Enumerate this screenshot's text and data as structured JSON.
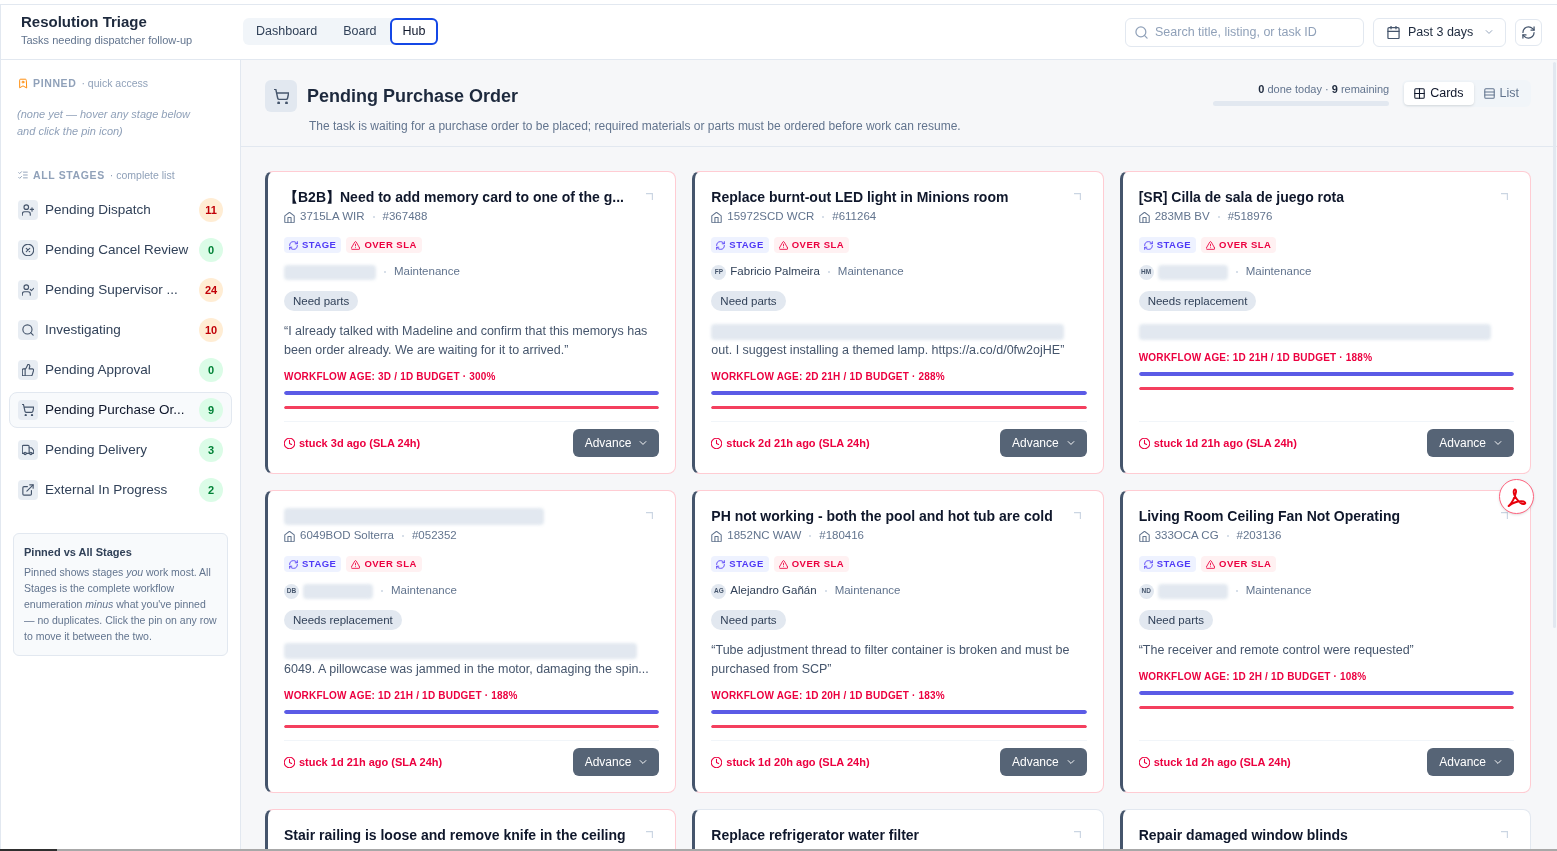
{
  "header": {
    "title": "Resolution Triage",
    "subtitle": "Tasks needing dispatcher follow-up",
    "tabs": [
      {
        "label": "Dashboard",
        "selected": false
      },
      {
        "label": "Board",
        "selected": false
      },
      {
        "label": "Hub",
        "selected": true
      }
    ],
    "search": {
      "placeholder": "Search title, listing, or task ID"
    },
    "date_range": {
      "label": "Past 3 days"
    }
  },
  "sidebar": {
    "pinned": {
      "heading": "PINNED",
      "note": "· quick access",
      "empty_text": "(none yet — hover any stage below and click the pin icon)"
    },
    "all_stages": {
      "heading": "ALL STAGES",
      "note": "· complete list",
      "items": [
        {
          "label": "Pending Dispatch",
          "count": "11",
          "warning": true,
          "selected": false
        },
        {
          "label": "Pending Cancel Review",
          "count": "0",
          "warning": false,
          "selected": false
        },
        {
          "label": "Pending Supervisor ...",
          "count": "24",
          "warning": true,
          "selected": false
        },
        {
          "label": "Investigating",
          "count": "10",
          "warning": true,
          "selected": false
        },
        {
          "label": "Pending Approval",
          "count": "0",
          "warning": false,
          "selected": false
        },
        {
          "label": "Pending Purchase Or...",
          "count": "9",
          "warning": false,
          "selected": true
        },
        {
          "label": "Pending Delivery",
          "count": "3",
          "warning": false,
          "selected": false
        },
        {
          "label": "External In Progress",
          "count": "2",
          "warning": false,
          "selected": false
        }
      ]
    },
    "info": {
      "title": "Pinned vs All Stages",
      "text": "Pinned shows stages *you* work most. All Stages is the complete workflow enumeration *minus* what you've pinned — no duplicates. Click the pin on any row to move it between the two."
    }
  },
  "stage_header": {
    "title": "Pending Purchase Order",
    "description": "The task is waiting for a purchase order to be placed; required materials or parts must be ordered before work can resume.",
    "progress_text": "**0** done today · **9** remaining",
    "progress": {
      "level": 0
    },
    "views": [
      {
        "label": "Cards",
        "selected": true
      },
      {
        "label": "List",
        "selected": false
      }
    ]
  },
  "card_rows": [
    {
      "cards": [
        {
          "overdue": true,
          "title": {
            "kind": "text",
            "text": "【B2B】Need to add memory card to one of the g..."
          },
          "listing": "3715LA WIR",
          "task_id": "#367488",
          "badges": [
            {
              "kind": "stage",
              "label": "STAGE"
            },
            {
              "kind": "over_sla",
              "label": "OVER SLA"
            }
          ],
          "assignee": {
            "name": {
              "kind": "redacted"
            }
          },
          "team": "Maintenance",
          "tag": "Need parts",
          "note": [
            {
              "kind": "text",
              "text": "“I already talked with Madeline and confirm that this memorys has been order already. We are waiting for it to arrived.”"
            }
          ],
          "age": "WORKFLOW AGE: 3D / 1D BUDGET · 300%",
          "bars": [
            {
              "level": 1,
              "color": "#5b5be6"
            },
            {
              "level": 1,
              "color": "#f43f5e"
            }
          ],
          "stuck": "stuck 3d ago (SLA 24h)",
          "action": "Advance"
        },
        {
          "overdue": true,
          "title": {
            "kind": "text",
            "text": "Replace burnt-out LED light in Minions room"
          },
          "listing": "15972SCD WCR",
          "task_id": "#611264",
          "badges": [
            {
              "kind": "stage",
              "label": "STAGE"
            },
            {
              "kind": "over_sla",
              "label": "OVER SLA"
            }
          ],
          "assignee": {
            "initials": "FP",
            "name": {
              "kind": "text",
              "text": "Fabricio Palmeira"
            }
          },
          "team": "Maintenance",
          "tag": "Need parts",
          "note": [
            {
              "kind": "redacted"
            },
            {
              "kind": "text",
              "text": "out. I suggest installing a themed lamp. https://a.co/d/0fw2ojHE”"
            }
          ],
          "age": "WORKFLOW AGE: 2D 21H / 1D BUDGET · 288%",
          "bars": [
            {
              "level": 1,
              "color": "#5b5be6"
            },
            {
              "level": 1,
              "color": "#f43f5e"
            }
          ],
          "stuck": "stuck 2d 21h ago (SLA 24h)",
          "action": "Advance"
        },
        {
          "overdue": true,
          "title": {
            "kind": "text",
            "text": "[SR] Cilla de sala de juego rota"
          },
          "listing": "283MB BV",
          "task_id": "#518976",
          "badges": [
            {
              "kind": "stage",
              "label": "STAGE"
            },
            {
              "kind": "over_sla",
              "label": "OVER SLA"
            }
          ],
          "assignee": {
            "initials": "HM",
            "name": {
              "kind": "redacted"
            }
          },
          "team": "Maintenance",
          "tag": "Needs replacement",
          "note": [
            {
              "kind": "redacted"
            }
          ],
          "age": "WORKFLOW AGE: 1D 21H / 1D BUDGET · 188%",
          "bars": [
            {
              "level": 1,
              "color": "#5b5be6"
            },
            {
              "level": 1,
              "color": "#f43f5e"
            }
          ],
          "stuck": "stuck 1d 21h ago (SLA 24h)",
          "action": "Advance"
        }
      ]
    },
    {
      "cards": [
        {
          "overdue": true,
          "title": {
            "kind": "redacted"
          },
          "listing": "6049BOD Solterra",
          "task_id": "#052352",
          "badges": [
            {
              "kind": "stage",
              "label": "STAGE"
            },
            {
              "kind": "over_sla",
              "label": "OVER SLA"
            }
          ],
          "assignee": {
            "initials": "DB",
            "name": {
              "kind": "redacted"
            }
          },
          "team": "Maintenance",
          "tag": "Needs replacement",
          "note": [
            {
              "kind": "redacted"
            },
            {
              "kind": "text",
              "text": "6049. A pillowcase was jammed in the motor, damaging the spin..."
            }
          ],
          "age": "WORKFLOW AGE: 1D 21H / 1D BUDGET · 188%",
          "bars": [
            {
              "level": 1,
              "color": "#5b5be6"
            },
            {
              "level": 1,
              "color": "#f43f5e"
            }
          ],
          "stuck": "stuck 1d 21h ago (SLA 24h)",
          "action": "Advance"
        },
        {
          "overdue": true,
          "title": {
            "kind": "text",
            "text": "PH not working - both the pool and hot tub are cold"
          },
          "listing": "1852NC WAW",
          "task_id": "#180416",
          "badges": [
            {
              "kind": "stage",
              "label": "STAGE"
            },
            {
              "kind": "over_sla",
              "label": "OVER SLA"
            }
          ],
          "assignee": {
            "initials": "AG",
            "name": {
              "kind": "text",
              "text": "Alejandro Gañán"
            }
          },
          "team": "Maintenance",
          "tag": "Need parts",
          "note": [
            {
              "kind": "text",
              "text": "“Tube adjustment thread to filter container is broken and must be purchased from SCP”"
            }
          ],
          "age": "WORKFLOW AGE: 1D 20H / 1D BUDGET · 183%",
          "bars": [
            {
              "level": 1,
              "color": "#5b5be6"
            },
            {
              "level": 1,
              "color": "#f43f5e"
            }
          ],
          "stuck": "stuck 1d 20h ago (SLA 24h)",
          "action": "Advance"
        },
        {
          "overdue": true,
          "title": {
            "kind": "text",
            "text": "Living Room Ceiling Fan Not Operating"
          },
          "listing": "333OCA CG",
          "task_id": "#203136",
          "badges": [
            {
              "kind": "stage",
              "label": "STAGE"
            },
            {
              "kind": "over_sla",
              "label": "OVER SLA"
            }
          ],
          "assignee": {
            "initials": "ND",
            "name": {
              "kind": "redacted"
            }
          },
          "team": "Maintenance",
          "tag": "Need parts",
          "note": [
            {
              "kind": "text",
              "text": "“The receiver and remote control were requested”"
            }
          ],
          "age": "WORKFLOW AGE: 1D 2H / 1D BUDGET · 108%",
          "bars": [
            {
              "level": 1,
              "color": "#5b5be6"
            },
            {
              "level": 1,
              "color": "#f43f5e"
            }
          ],
          "stuck": "stuck 1d 2h ago (SLA 24h)",
          "action": "Advance"
        }
      ]
    },
    {
      "cards": [
        {
          "overdue": true,
          "title": {
            "kind": "text",
            "text": "Stair railing is loose and remove knife in the ceiling"
          }
        },
        {
          "overdue": false,
          "title": {
            "kind": "text",
            "text": "Replace refrigerator water filter"
          }
        },
        {
          "overdue": false,
          "title": {
            "kind": "text",
            "text": "Repair damaged window blinds"
          }
        }
      ]
    }
  ]
}
